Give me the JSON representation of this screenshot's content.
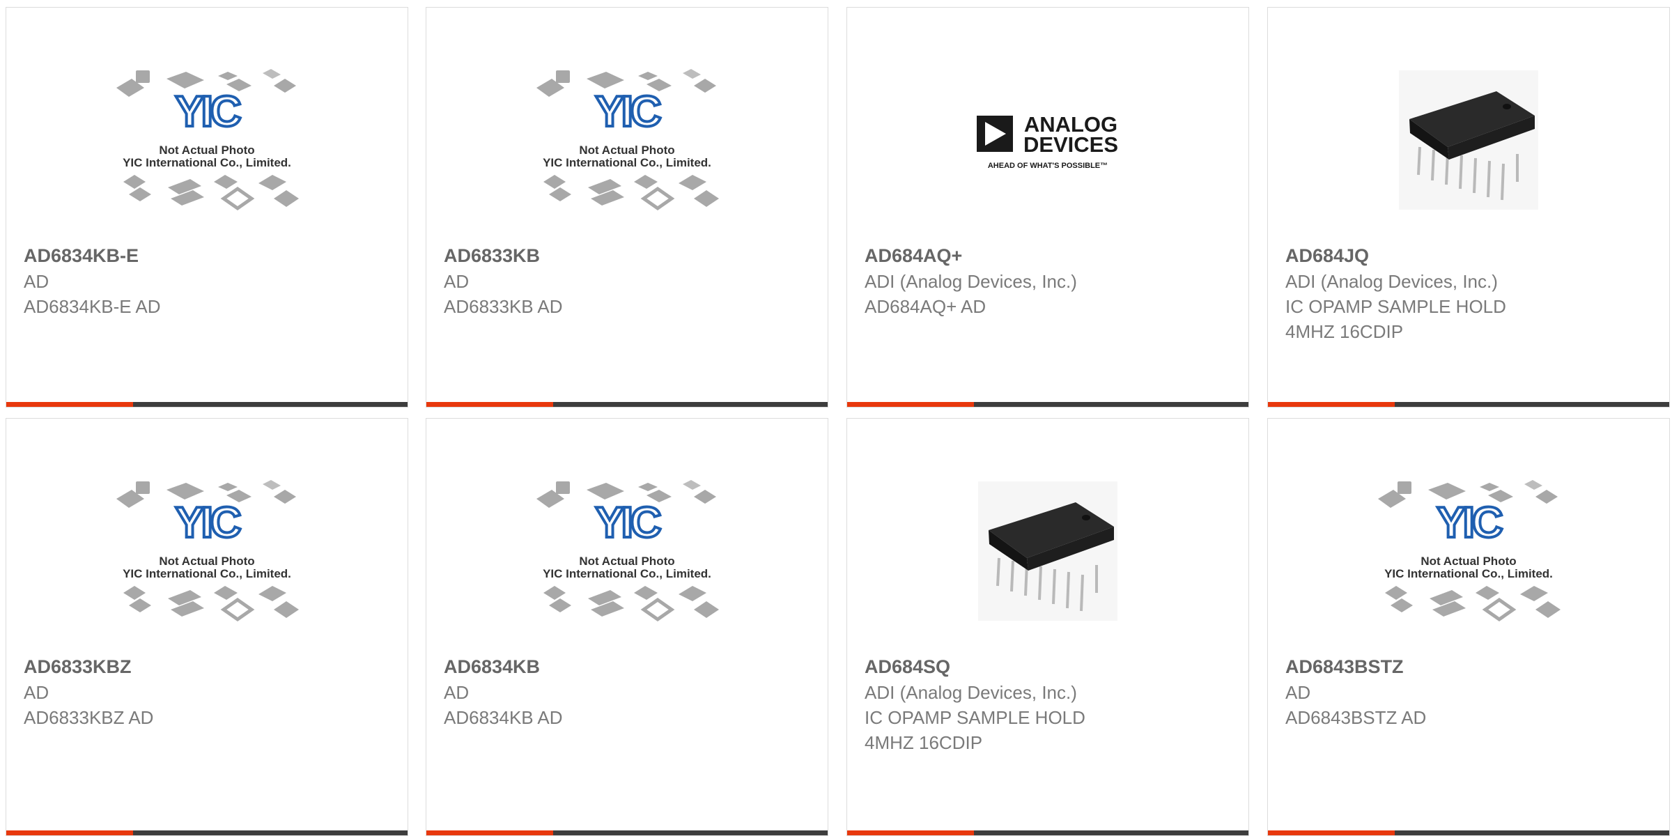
{
  "products": [
    {
      "part_number": "AD6834KB-E",
      "manufacturer": "AD",
      "description": "AD6834KB-E AD",
      "image": "yic-placeholder"
    },
    {
      "part_number": "AD6833KB",
      "manufacturer": "AD",
      "description": "AD6833KB AD",
      "image": "yic-placeholder"
    },
    {
      "part_number": "AD684AQ+",
      "manufacturer": "ADI (Analog Devices, Inc.)",
      "description": "AD684AQ+ AD",
      "image": "analog-devices-logo"
    },
    {
      "part_number": "AD684JQ",
      "manufacturer": "ADI (Analog Devices, Inc.)",
      "description": "IC OPAMP SAMPLE HOLD 4MHZ 16CDIP",
      "image": "dip-chip-photo"
    },
    {
      "part_number": "AD6833KBZ",
      "manufacturer": "AD",
      "description": "AD6833KBZ AD",
      "image": "yic-placeholder"
    },
    {
      "part_number": "AD6834KB",
      "manufacturer": "AD",
      "description": "AD6834KB AD",
      "image": "yic-placeholder"
    },
    {
      "part_number": "AD684SQ",
      "manufacturer": "ADI (Analog Devices, Inc.)",
      "description": "IC OPAMP SAMPLE HOLD 4MHZ 16CDIP",
      "image": "dip-chip-photo"
    },
    {
      "part_number": "AD6843BSTZ",
      "manufacturer": "AD",
      "description": "AD6843BSTZ AD",
      "image": "yic-placeholder"
    }
  ],
  "placeholder": {
    "brand": "YIC",
    "line1": "Not Actual Photo",
    "line2": "YIC International Co., Limited."
  },
  "adi_logo": {
    "line1": "ANALOG",
    "line2": "DEVICES",
    "tagline": "AHEAD OF WHAT'S POSSIBLE™"
  },
  "colors": {
    "accent": "#e8380d",
    "bar": "#3d3d3d",
    "brand_blue": "#1f5fb0"
  }
}
